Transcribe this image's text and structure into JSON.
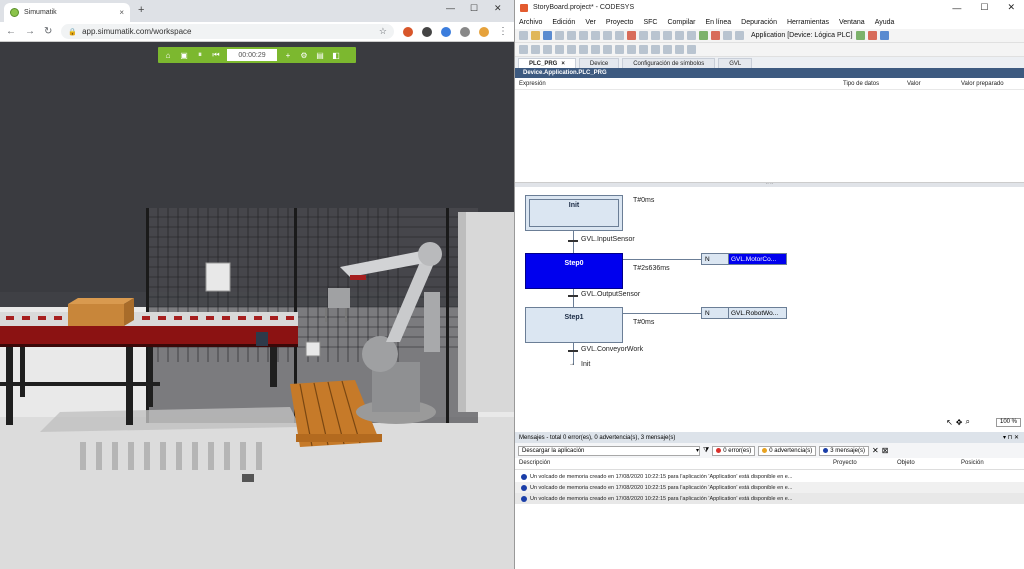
{
  "browser": {
    "tab_title": "Simumatik",
    "tab_close": "×",
    "new_tab": "+",
    "win_min": "—",
    "win_max": "☐",
    "win_close": "✕",
    "url": "app.simumatik.com/workspace",
    "nav_back": "←",
    "nav_forward": "→",
    "nav_reload": "↻",
    "star": "☆",
    "menu": "⋮",
    "lock": "🔒"
  },
  "sim_toolbar": {
    "home": "⌂",
    "save": "▣",
    "pause": "⏸",
    "rewind": "⏮",
    "time": "00:00:29",
    "add": "+",
    "settings": "⚙",
    "layers": "▤",
    "view": "◧"
  },
  "codesys": {
    "window_title": "StoryBoard.project* - CODESYS",
    "menu": [
      "Archivo",
      "Edición",
      "Ver",
      "Proyecto",
      "SFC",
      "Compilar",
      "En línea",
      "Depuración",
      "Herramientas",
      "Ventana",
      "Ayuda"
    ],
    "application_selector": "Application [Device: Lógica PLC]",
    "doc_tabs": [
      "PLC_PRG",
      "Device",
      "Configuración de símbolos",
      "GVL"
    ],
    "pou_title": "Device.Application.PLC_PRG",
    "var_columns": [
      "Expresión",
      "Tipo de datos",
      "Valor",
      "Valor preparado"
    ],
    "sfc": {
      "steps": [
        {
          "name": "Init",
          "time": "T#0ms"
        },
        {
          "name": "Step0",
          "time": "T#2s636ms"
        },
        {
          "name": "Step1",
          "time": "T#0ms"
        }
      ],
      "transitions": [
        "GVL.InputSensor",
        "GVL.OutputSensor",
        "GVL.ConveyorWork"
      ],
      "jump": "Init",
      "actions": [
        {
          "qualifier": "N",
          "name": "GVL.MotorCo..."
        },
        {
          "qualifier": "N",
          "name": "GVL.RobotWo..."
        }
      ],
      "zoom": "100 %"
    },
    "messages": {
      "title": "Mensajes - total 0 error(es), 0 advertencia(s), 3 mensaje(s)",
      "source": "Descargar la aplicación",
      "errors": "0 error(es)",
      "warnings": "0 advertencia(s)",
      "info": "3 mensaje(s)",
      "columns": [
        "Descripción",
        "Proyecto",
        "Objeto",
        "Posición"
      ],
      "rows": [
        "Un volcado de memoria creado en 17/08/2020 10:22:15 para l'aplicación 'Application' está disponible en e...",
        "Un volcado de memoria creado en 17/08/2020 10:22:15 para l'aplicación 'Application' está disponible en e...",
        "Un volcado de memoria creado en 17/08/2020 10:22:15 para l'aplicación 'Application' está disponible en e..."
      ]
    }
  }
}
